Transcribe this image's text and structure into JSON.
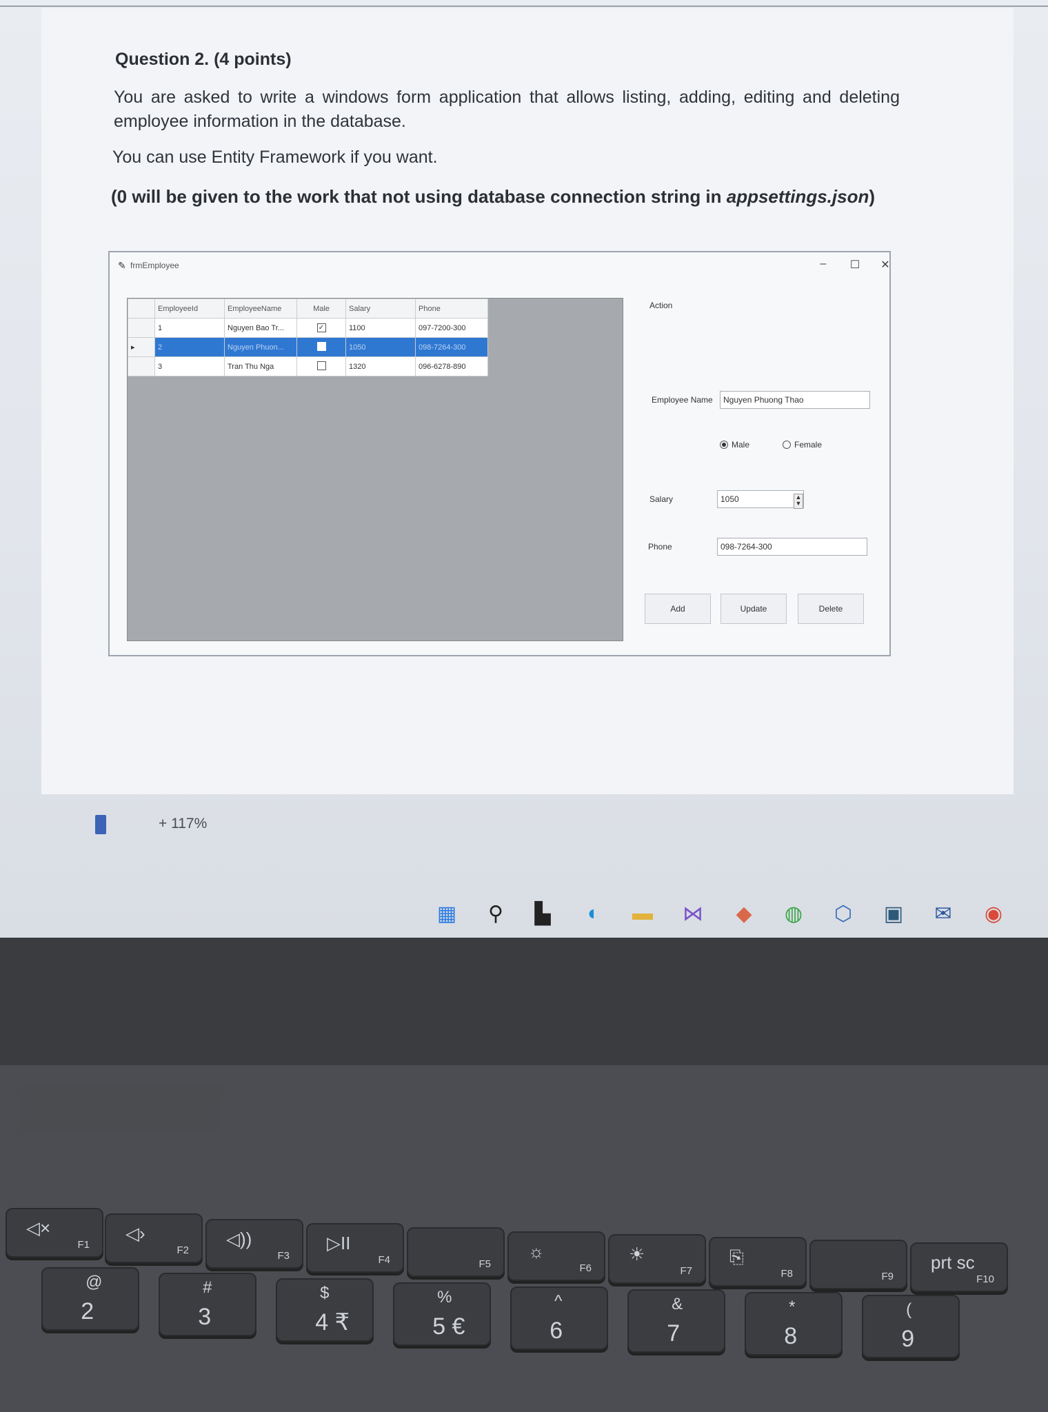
{
  "question": {
    "title": "Question 2. (4 points)",
    "paragraph1": "You are asked to write a windows form application that allows listing, adding, editing and deleting employee information in the database.",
    "paragraph2": "You can use Entity Framework if you want.",
    "paragraph3_prefix": "(0 will be given to the work that not using database connection string in ",
    "paragraph3_file": "appsettings.json",
    "paragraph3_suffix": ")"
  },
  "form": {
    "title": "frmEmployee",
    "window_controls": {
      "minimize": "–",
      "maximize": "☐",
      "close": "✕"
    },
    "grid": {
      "columns": [
        "EmployeeId",
        "EmployeeName",
        "Male",
        "Salary",
        "Phone"
      ],
      "rows": [
        {
          "id": "1",
          "name": "Nguyen Bao Tr...",
          "male": true,
          "salary": "1100",
          "phone": "097-7200-300",
          "selected": false
        },
        {
          "id": "2",
          "name": "Nguyen Phuon...",
          "male": true,
          "salary": "1050",
          "phone": "098-7264-300",
          "selected": true
        },
        {
          "id": "3",
          "name": "Tran Thu Nga",
          "male": false,
          "salary": "1320",
          "phone": "096-6278-890",
          "selected": false
        }
      ]
    },
    "action_label": "Action",
    "employee_name_label": "Employee Name",
    "employee_name_value": "Nguyen Phuong Thao",
    "gender": {
      "male_label": "Male",
      "female_label": "Female",
      "selected": "Male"
    },
    "salary_label": "Salary",
    "salary_value": "1050",
    "phone_label": "Phone",
    "phone_value": "098-7264-300",
    "buttons": {
      "add": "Add",
      "update": "Update",
      "delete": "Delete"
    }
  },
  "zoom": {
    "label": "+ 117%"
  },
  "taskbar": {
    "icons": [
      "windows-start-icon",
      "search-icon",
      "task-view-icon",
      "edge-icon",
      "file-explorer-icon",
      "visual-studio-icon",
      "app-icon",
      "app-icon-2",
      "cube-icon",
      "app-icon-3",
      "mail-icon",
      "chrome-icon"
    ]
  },
  "keyboard": {
    "function_row": [
      {
        "symbol": "◁×",
        "fn": "F1"
      },
      {
        "symbol": "◁›",
        "fn": "F2"
      },
      {
        "symbol": "◁))",
        "fn": "F3"
      },
      {
        "symbol": "▷II",
        "fn": "F4"
      },
      {
        "symbol": "",
        "fn": "F5"
      },
      {
        "symbol": "☼",
        "fn": "F6"
      },
      {
        "symbol": "☀",
        "fn": "F7"
      },
      {
        "symbol": "⎘",
        "fn": "F8"
      },
      {
        "symbol": "",
        "fn": "F9"
      },
      {
        "symbol": "prt sc",
        "fn": "F10"
      }
    ],
    "number_row": [
      {
        "top": "@",
        "bottom": "2"
      },
      {
        "top": "#",
        "bottom": "3"
      },
      {
        "top": "$",
        "bottom": "4 ₹"
      },
      {
        "top": "%",
        "bottom": "5 €"
      },
      {
        "top": "^",
        "bottom": "6"
      },
      {
        "top": "&",
        "bottom": "7"
      },
      {
        "top": "*",
        "bottom": "8"
      },
      {
        "top": "(",
        "bottom": "9"
      }
    ]
  },
  "colors": {
    "selection": "#2f78d2",
    "grid_background": "#a6a9ad",
    "screen_background": "#e6e9ee",
    "keyboard": "#3b3d41"
  }
}
